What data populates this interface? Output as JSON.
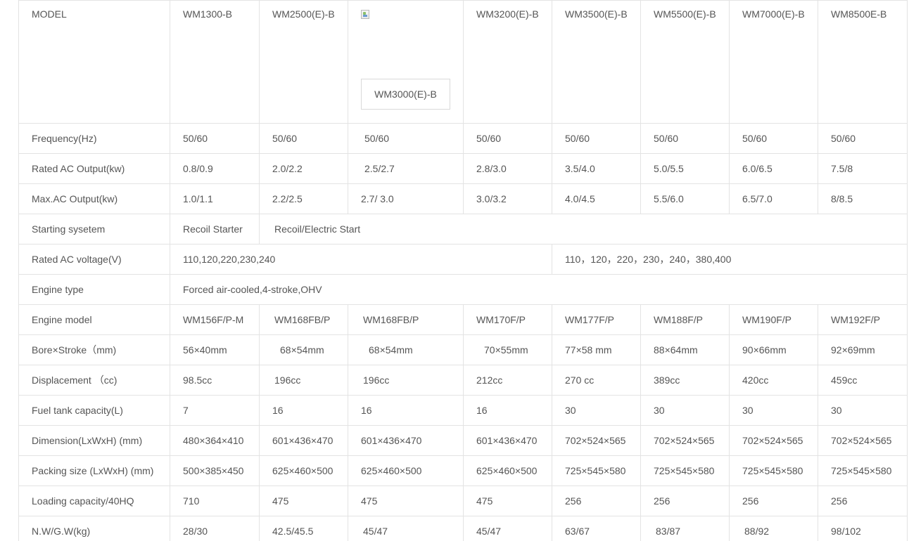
{
  "header": {
    "label": "MODEL",
    "models": [
      "WM1300-B",
      "WM2500(E)-B",
      "WM3000(E)-B",
      "WM3200(E)-B",
      "WM3500(E)-B",
      "WM5500(E)-B",
      "WM7000(E)-B",
      "WM8500E-B"
    ]
  },
  "rows": {
    "frequency": {
      "label": "Frequency(Hz)",
      "values": [
        "50/60",
        "50/60",
        "50/60",
        "50/60",
        "50/60",
        "50/60",
        "50/60",
        "50/60"
      ]
    },
    "rated_output": {
      "label": "Rated AC Output(kw)",
      "values": [
        "0.8/0.9",
        "2.0/2.2",
        "2.5/2.7",
        "2.8/3.0",
        "3.5/4.0",
        "5.0/5.5",
        "6.0/6.5",
        "7.5/8"
      ]
    },
    "max_output": {
      "label": "Max.AC Output(kw)",
      "values": [
        "1.0/1.1",
        "2.2/2.5",
        "2.7/ 3.0",
        "3.0/3.2",
        "4.0/4.5",
        "5.5/6.0",
        "6.5/7.0",
        "8/8.5"
      ]
    },
    "starting": {
      "label": "Starting sysetem",
      "values": [
        "Recoil Starter",
        "Recoil/Electric Start"
      ]
    },
    "voltage": {
      "label": "Rated AC voltage(V)",
      "values": [
        "110,120,220,230,240",
        "110，120，220，230，240，380,400"
      ]
    },
    "engine_type": {
      "label": "Engine type",
      "values": [
        "Forced air-cooled,4-stroke,OHV"
      ]
    },
    "engine_model": {
      "label": "Engine model",
      "values": [
        "WM156F/P-M",
        "WM168FB/P",
        "WM168FB/P",
        "WM170F/P",
        "WM177F/P",
        "WM188F/P",
        "WM190F/P",
        "WM192F/P"
      ]
    },
    "bore_stroke": {
      "label": "Bore×Stroke（mm)",
      "values": [
        "56×40mm",
        "68×54mm",
        "68×54mm",
        "70×55mm",
        "77×58 mm",
        "88×64mm",
        "90×66mm",
        "92×69mm"
      ]
    },
    "displacement": {
      "label": "Displacement （cc)",
      "values": [
        "98.5cc",
        "196cc",
        "196cc",
        "212cc",
        "270 cc",
        "389cc",
        "420cc",
        "459cc"
      ]
    },
    "fuel_tank": {
      "label": "Fuel tank capacity(L)",
      "values": [
        "7",
        "16",
        "16",
        "16",
        "30",
        "30",
        "30",
        "30"
      ]
    },
    "dimension": {
      "label": "Dimension(LxWxH) (mm)",
      "values": [
        "480×364×410",
        "601×436×470",
        "601×436×470",
        "601×436×470",
        "702×524×565",
        "702×524×565",
        "702×524×565",
        "702×524×565"
      ]
    },
    "packing": {
      "label": "Packing size (LxWxH) (mm)",
      "values": [
        "500×385×450",
        "625×460×500",
        "625×460×500",
        "625×460×500",
        "725×545×580",
        "725×545×580",
        "725×545×580",
        "725×545×580"
      ]
    },
    "loading": {
      "label": "Loading capacity/40HQ",
      "values": [
        "710",
        "475",
        "475",
        "475",
        "256",
        "256",
        "256",
        "256"
      ]
    },
    "weight": {
      "label": "N.W/G.W(kg)",
      "values": [
        "28/30",
        "42.5/45.5",
        "45/47",
        "45/47",
        "63/67",
        "83/87",
        "88/92",
        "98/102"
      ]
    }
  },
  "icons": {
    "model_image": "broken-image-icon"
  }
}
